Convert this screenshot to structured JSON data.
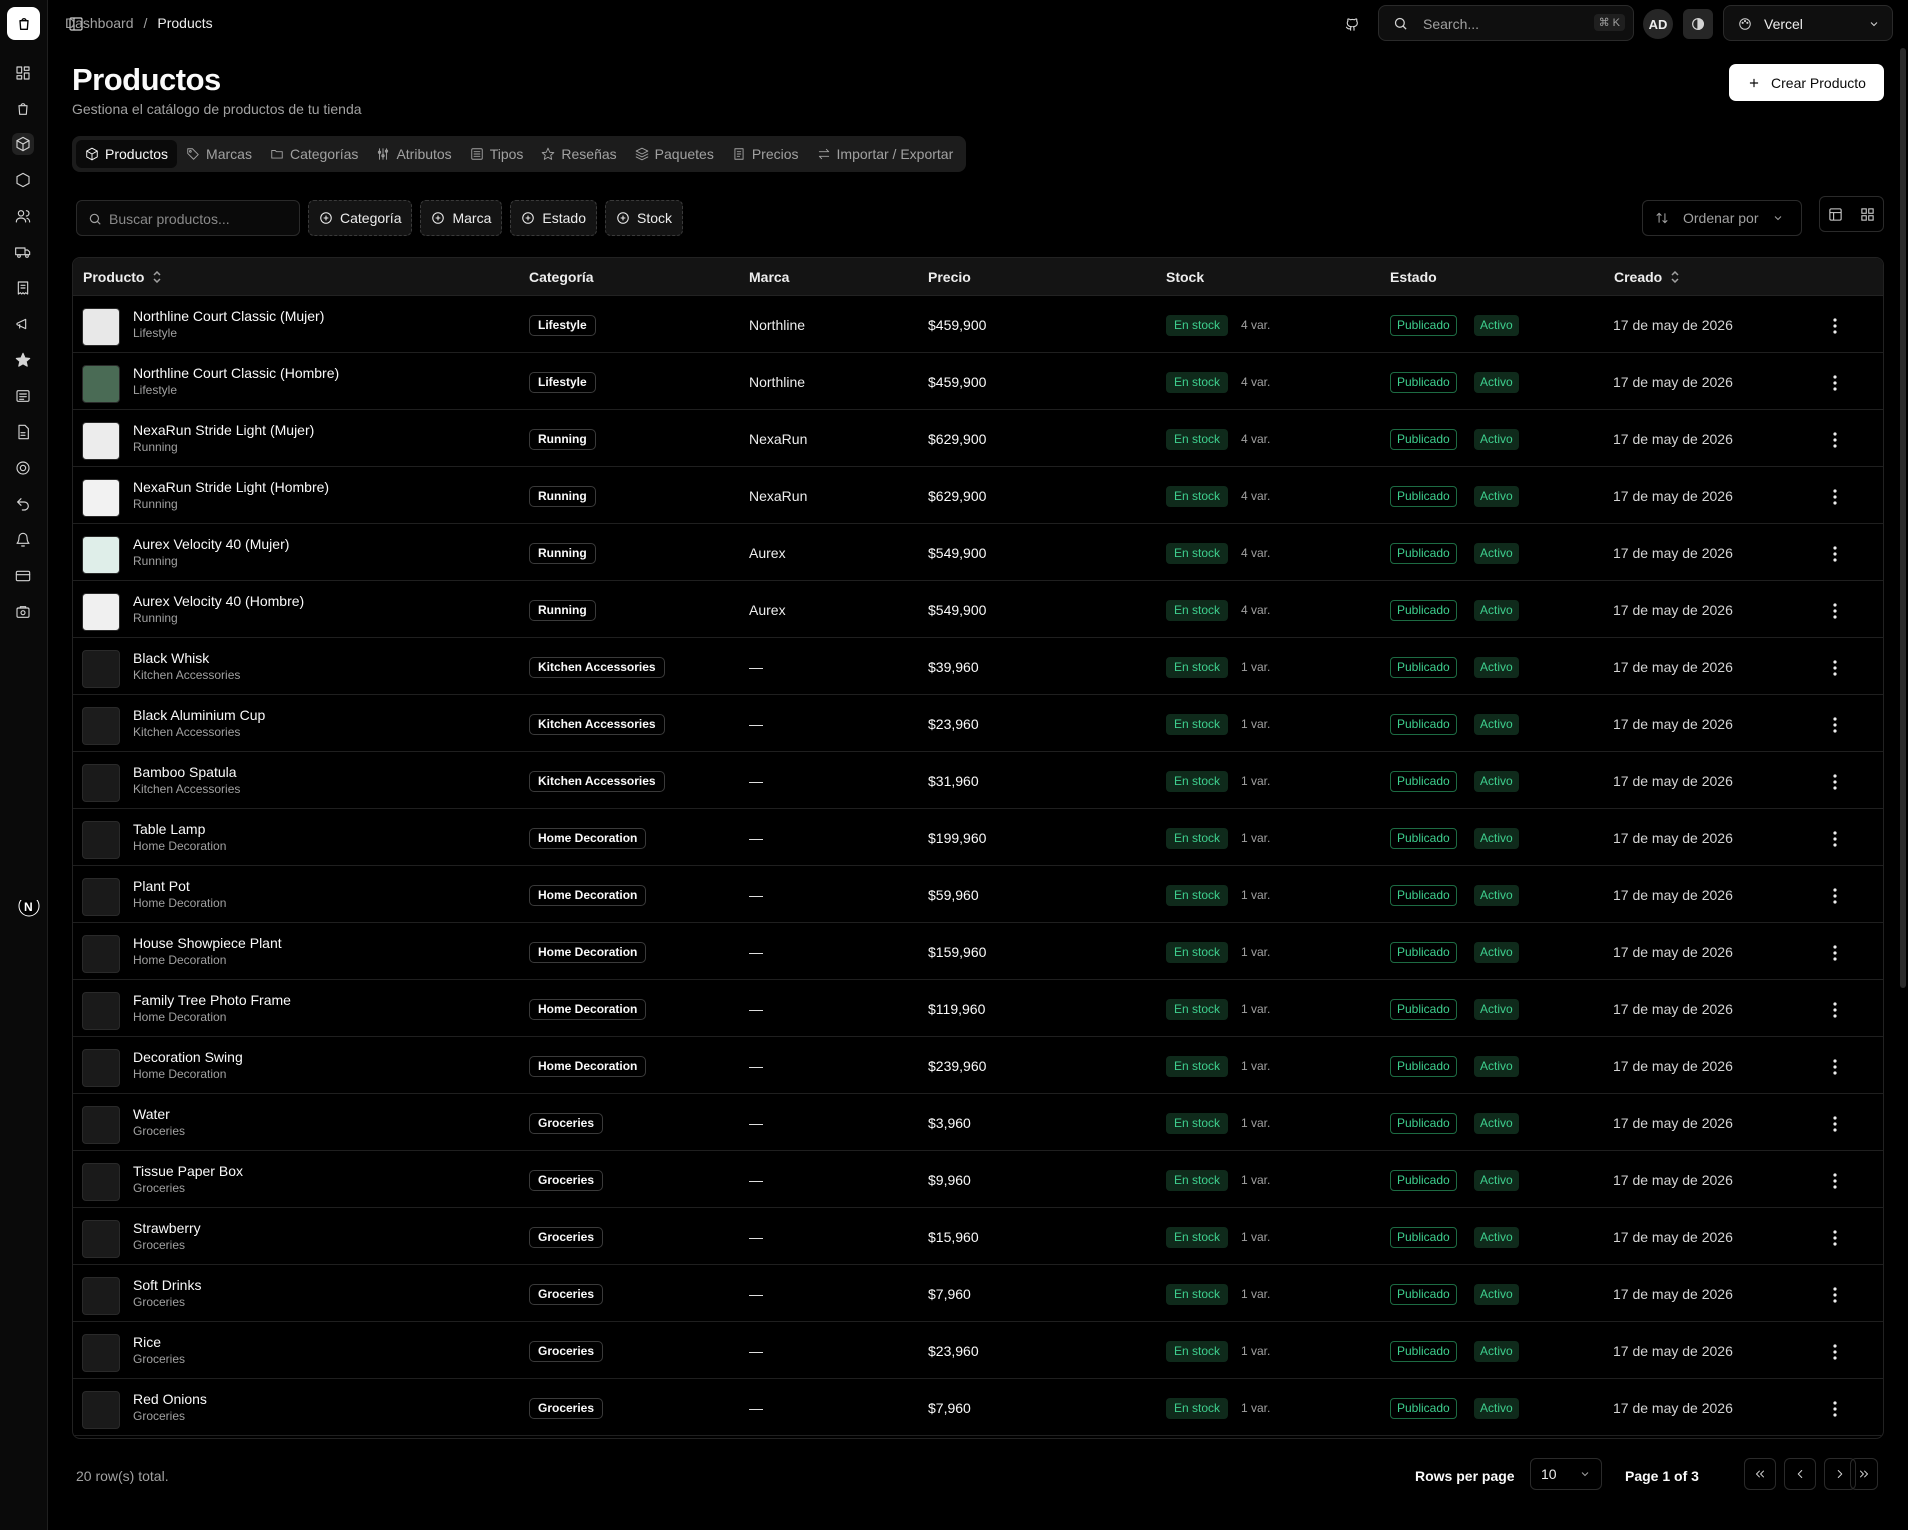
{
  "breadcrumb": {
    "root": "Dashboard",
    "sep": "/",
    "current": "Products"
  },
  "search": {
    "placeholder": "Search...",
    "shortcut": "⌘ K"
  },
  "user": {
    "initials": "AD"
  },
  "team": {
    "name": "Vercel"
  },
  "page": {
    "title": "Productos",
    "subtitle": "Gestiona el catálogo de productos de tu tienda",
    "create_label": "Crear Producto"
  },
  "tabs": [
    {
      "label": "Productos",
      "icon": "package-icon"
    },
    {
      "label": "Marcas",
      "icon": "tag-icon"
    },
    {
      "label": "Categorías",
      "icon": "folder-icon"
    },
    {
      "label": "Atributos",
      "icon": "sliders-icon"
    },
    {
      "label": "Tipos",
      "icon": "list-icon"
    },
    {
      "label": "Reseñas",
      "icon": "star-icon"
    },
    {
      "label": "Paquetes",
      "icon": "layers-icon"
    },
    {
      "label": "Precios",
      "icon": "receipt-icon"
    },
    {
      "label": "Importar / Exportar",
      "icon": "arrows-icon"
    }
  ],
  "filters": {
    "search_placeholder": "Buscar productos...",
    "buttons": [
      "Categoría",
      "Marca",
      "Estado",
      "Stock"
    ],
    "sort_label": "Ordenar por"
  },
  "columns": {
    "product": "Producto",
    "category": "Categoría",
    "brand": "Marca",
    "price": "Precio",
    "stock": "Stock",
    "status": "Estado",
    "created": "Creado"
  },
  "rows": [
    {
      "name": "Northline Court Classic (Mujer)",
      "sub": "Lifestyle",
      "category": "Lifestyle",
      "brand": "Northline",
      "price": "$459,900",
      "stock": "En stock",
      "variants": "4 var.",
      "status1": "Publicado",
      "status2": "Activo",
      "created": "17 de may de 2026",
      "thumb_color": "#e8e8e8"
    },
    {
      "name": "Northline Court Classic (Hombre)",
      "sub": "Lifestyle",
      "category": "Lifestyle",
      "brand": "Northline",
      "price": "$459,900",
      "stock": "En stock",
      "variants": "4 var.",
      "status1": "Publicado",
      "status2": "Activo",
      "created": "17 de may de 2026",
      "thumb_color": "#4a6b55"
    },
    {
      "name": "NexaRun Stride Light (Mujer)",
      "sub": "Running",
      "category": "Running",
      "brand": "NexaRun",
      "price": "$629,900",
      "stock": "En stock",
      "variants": "4 var.",
      "status1": "Publicado",
      "status2": "Activo",
      "created": "17 de may de 2026",
      "thumb_color": "#ececec"
    },
    {
      "name": "NexaRun Stride Light (Hombre)",
      "sub": "Running",
      "category": "Running",
      "brand": "NexaRun",
      "price": "$629,900",
      "stock": "En stock",
      "variants": "4 var.",
      "status1": "Publicado",
      "status2": "Activo",
      "created": "17 de may de 2026",
      "thumb_color": "#f2f2f2"
    },
    {
      "name": "Aurex Velocity 40 (Mujer)",
      "sub": "Running",
      "category": "Running",
      "brand": "Aurex",
      "price": "$549,900",
      "stock": "En stock",
      "variants": "4 var.",
      "status1": "Publicado",
      "status2": "Activo",
      "created": "17 de may de 2026",
      "thumb_color": "#dfeee9"
    },
    {
      "name": "Aurex Velocity 40 (Hombre)",
      "sub": "Running",
      "category": "Running",
      "brand": "Aurex",
      "price": "$549,900",
      "stock": "En stock",
      "variants": "4 var.",
      "status1": "Publicado",
      "status2": "Activo",
      "created": "17 de may de 2026",
      "thumb_color": "#f0f0f0"
    },
    {
      "name": "Black Whisk",
      "sub": "Kitchen Accessories",
      "category": "Kitchen Accessories",
      "brand": "—",
      "price": "$39,960",
      "stock": "En stock",
      "variants": "1 var.",
      "status1": "Publicado",
      "status2": "Activo",
      "created": "17 de may de 2026",
      "thumb_color": "#1a1a1a"
    },
    {
      "name": "Black Aluminium Cup",
      "sub": "Kitchen Accessories",
      "category": "Kitchen Accessories",
      "brand": "—",
      "price": "$23,960",
      "stock": "En stock",
      "variants": "1 var.",
      "status1": "Publicado",
      "status2": "Activo",
      "created": "17 de may de 2026",
      "thumb_color": "#1c1c1c"
    },
    {
      "name": "Bamboo Spatula",
      "sub": "Kitchen Accessories",
      "category": "Kitchen Accessories",
      "brand": "—",
      "price": "$31,960",
      "stock": "En stock",
      "variants": "1 var.",
      "status1": "Publicado",
      "status2": "Activo",
      "created": "17 de may de 2026",
      "thumb_color": "#1a1a1a"
    },
    {
      "name": "Table Lamp",
      "sub": "Home Decoration",
      "category": "Home Decoration",
      "brand": "—",
      "price": "$199,960",
      "stock": "En stock",
      "variants": "1 var.",
      "status1": "Publicado",
      "status2": "Activo",
      "created": "17 de may de 2026",
      "thumb_color": "#1a1a1a"
    },
    {
      "name": "Plant Pot",
      "sub": "Home Decoration",
      "category": "Home Decoration",
      "brand": "—",
      "price": "$59,960",
      "stock": "En stock",
      "variants": "1 var.",
      "status1": "Publicado",
      "status2": "Activo",
      "created": "17 de may de 2026",
      "thumb_color": "#1a1a1a"
    },
    {
      "name": "House Showpiece Plant",
      "sub": "Home Decoration",
      "category": "Home Decoration",
      "brand": "—",
      "price": "$159,960",
      "stock": "En stock",
      "variants": "1 var.",
      "status1": "Publicado",
      "status2": "Activo",
      "created": "17 de may de 2026",
      "thumb_color": "#1a1a1a"
    },
    {
      "name": "Family Tree Photo Frame",
      "sub": "Home Decoration",
      "category": "Home Decoration",
      "brand": "—",
      "price": "$119,960",
      "stock": "En stock",
      "variants": "1 var.",
      "status1": "Publicado",
      "status2": "Activo",
      "created": "17 de may de 2026",
      "thumb_color": "#1a1a1a"
    },
    {
      "name": "Decoration Swing",
      "sub": "Home Decoration",
      "category": "Home Decoration",
      "brand": "—",
      "price": "$239,960",
      "stock": "En stock",
      "variants": "1 var.",
      "status1": "Publicado",
      "status2": "Activo",
      "created": "17 de may de 2026",
      "thumb_color": "#1a1a1a"
    },
    {
      "name": "Water",
      "sub": "Groceries",
      "category": "Groceries",
      "brand": "—",
      "price": "$3,960",
      "stock": "En stock",
      "variants": "1 var.",
      "status1": "Publicado",
      "status2": "Activo",
      "created": "17 de may de 2026",
      "thumb_color": "#1a1a1a"
    },
    {
      "name": "Tissue Paper Box",
      "sub": "Groceries",
      "category": "Groceries",
      "brand": "—",
      "price": "$9,960",
      "stock": "En stock",
      "variants": "1 var.",
      "status1": "Publicado",
      "status2": "Activo",
      "created": "17 de may de 2026",
      "thumb_color": "#1a1a1a"
    },
    {
      "name": "Strawberry",
      "sub": "Groceries",
      "category": "Groceries",
      "brand": "—",
      "price": "$15,960",
      "stock": "En stock",
      "variants": "1 var.",
      "status1": "Publicado",
      "status2": "Activo",
      "created": "17 de may de 2026",
      "thumb_color": "#1a1a1a"
    },
    {
      "name": "Soft Drinks",
      "sub": "Groceries",
      "category": "Groceries",
      "brand": "—",
      "price": "$7,960",
      "stock": "En stock",
      "variants": "1 var.",
      "status1": "Publicado",
      "status2": "Activo",
      "created": "17 de may de 2026",
      "thumb_color": "#1a1a1a"
    },
    {
      "name": "Rice",
      "sub": "Groceries",
      "category": "Groceries",
      "brand": "—",
      "price": "$23,960",
      "stock": "En stock",
      "variants": "1 var.",
      "status1": "Publicado",
      "status2": "Activo",
      "created": "17 de may de 2026",
      "thumb_color": "#1a1a1a"
    },
    {
      "name": "Red Onions",
      "sub": "Groceries",
      "category": "Groceries",
      "brand": "—",
      "price": "$7,960",
      "stock": "En stock",
      "variants": "1 var.",
      "status1": "Publicado",
      "status2": "Activo",
      "created": "17 de may de 2026",
      "thumb_color": "#1a1a1a"
    }
  ],
  "footer": {
    "total": "20 row(s) total.",
    "rows_per_page_label": "Rows per page",
    "rows_per_page": "10",
    "page_info": "Page 1 of 3"
  },
  "colors": {
    "accent_green": "#3ecf8e",
    "background": "#000000"
  }
}
